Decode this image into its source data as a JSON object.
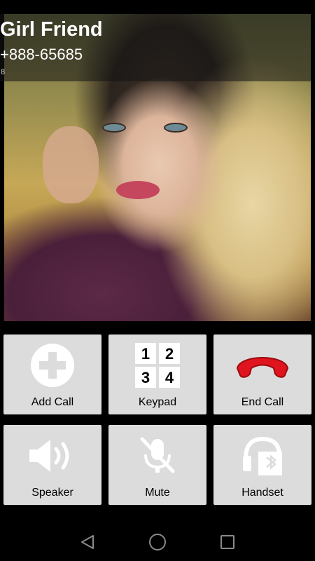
{
  "caller": {
    "name": "Girl Friend",
    "number": "+888-65685",
    "duration": "8"
  },
  "buttons": {
    "add_call": "Add Call",
    "keypad": "Keypad",
    "end_call": "End Call",
    "speaker": "Speaker",
    "mute": "Mute",
    "handset": "Handset"
  },
  "keypad_digits": [
    "1",
    "2",
    "3",
    "4"
  ],
  "colors": {
    "button_bg": "#dcdcdc",
    "end_call_red": "#e0141e",
    "icon_white": "#ffffff",
    "icon_black": "#000000"
  },
  "icons": {
    "add_call": "plus-circle-icon",
    "keypad": "keypad-icon",
    "end_call": "phone-hangup-icon",
    "speaker": "speaker-icon",
    "mute": "mic-off-icon",
    "handset": "bluetooth-headset-icon",
    "nav_back": "back-triangle-icon",
    "nav_home": "home-circle-icon",
    "nav_recents": "recents-square-icon"
  }
}
